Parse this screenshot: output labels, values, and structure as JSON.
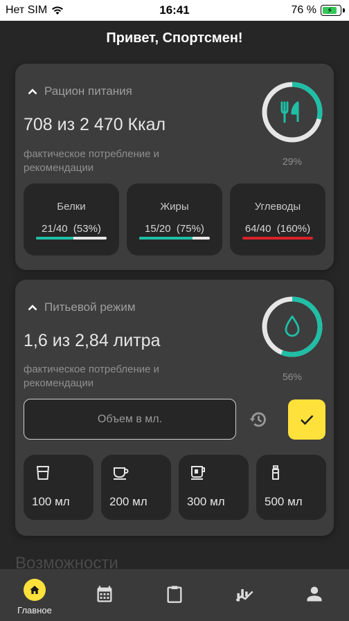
{
  "status_bar": {
    "carrier": "Нет SIM",
    "time": "16:41",
    "battery": "76 %"
  },
  "greeting": "Привет, Спортсмен!",
  "nutrition": {
    "title": "Рацион питания",
    "value": "708 из 2 470 Ккал",
    "subtitle": "фактическое потребление и рекомендации",
    "percent_label": "29%",
    "progress": 0.29,
    "icon": "fork-knife-icon",
    "macros": [
      {
        "name": "Белки",
        "value": "21/40  (53%)",
        "fill": 0.53,
        "color": "#1fbfa6"
      },
      {
        "name": "Жиры",
        "value": "15/20  (75%)",
        "fill": 0.75,
        "color": "#1fbfa6"
      },
      {
        "name": "Углеводы",
        "value": "64/40  (160%)",
        "fill": 1.0,
        "color": "#d8222a"
      }
    ]
  },
  "water": {
    "title": "Питьевой режим",
    "value": "1,6 из 2,84 литра",
    "subtitle": "фактическое потребление и рекомендации",
    "percent_label": "56%",
    "progress": 0.56,
    "icon": "water-drop-icon",
    "input_placeholder": "Объем в мл.",
    "cups": [
      {
        "label": "100 мл",
        "icon": "glass-icon"
      },
      {
        "label": "200 мл",
        "icon": "cup-icon"
      },
      {
        "label": "300 мл",
        "icon": "mug-icon"
      },
      {
        "label": "500 мл",
        "icon": "bottle-icon"
      }
    ]
  },
  "section_title": "Возможности",
  "tabbar": {
    "items": [
      {
        "label": "Главное",
        "icon": "home-icon",
        "active": true
      },
      {
        "label": "",
        "icon": "calendar-icon",
        "active": false
      },
      {
        "label": "",
        "icon": "clipboard-icon",
        "active": false
      },
      {
        "label": "",
        "icon": "chart-icon",
        "active": false
      },
      {
        "label": "",
        "icon": "profile-icon",
        "active": false
      }
    ]
  },
  "colors": {
    "accent": "#1fbfa6",
    "yellow": "#ffe13b",
    "red": "#d8222a",
    "card": "#3d3d3d",
    "background": "#262626"
  }
}
